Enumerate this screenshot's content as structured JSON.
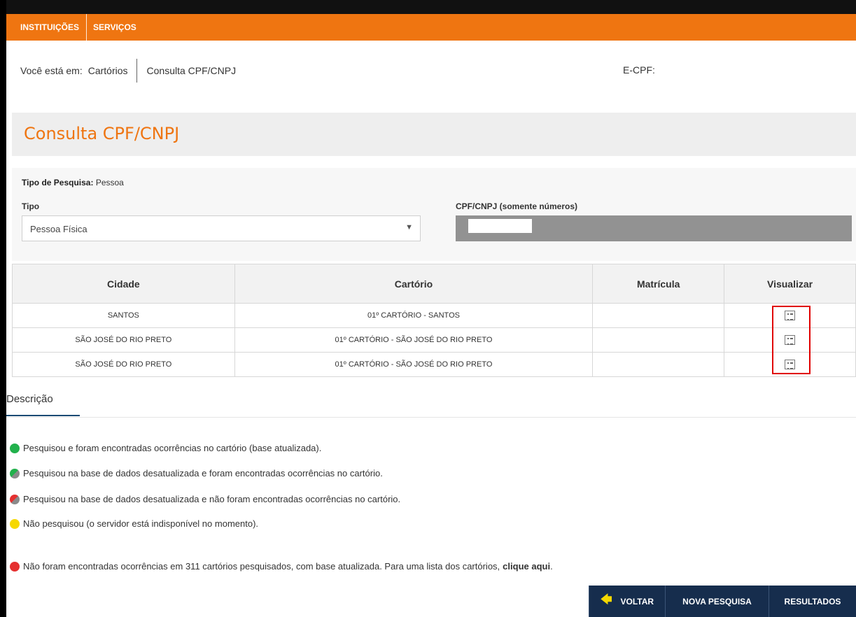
{
  "nav": {
    "items": [
      "INSTITUIÇÕES",
      "SERVIÇOS"
    ]
  },
  "breadcrumb": {
    "prefix": "Você está em:",
    "items": [
      "Cartórios",
      "Consulta CPF/CNPJ"
    ]
  },
  "header": {
    "ecpf_label": "E-CPF:"
  },
  "page_title": "Consulta CPF/CNPJ",
  "form": {
    "tipo_pesquisa_label": "Tipo de Pesquisa:",
    "tipo_pesquisa_value": "Pessoa",
    "tipo_label": "Tipo",
    "tipo_value": "Pessoa Física",
    "cpf_label": "CPF/CNPJ (somente números)",
    "cpf_value": ""
  },
  "table": {
    "headers": [
      "Cidade",
      "Cartório",
      "Matrícula",
      "Visualizar"
    ],
    "rows": [
      {
        "cidade": "SANTOS",
        "cartorio": "01º CARTÓRIO - SANTOS",
        "matricula": ""
      },
      {
        "cidade": "SÃO JOSÉ DO RIO PRETO",
        "cartorio": "01º CARTÓRIO - SÃO JOSÉ DO RIO PRETO",
        "matricula": ""
      },
      {
        "cidade": "SÃO JOSÉ DO RIO PRETO",
        "cartorio": "01º CARTÓRIO - SÃO JOSÉ DO RIO PRETO",
        "matricula": ""
      }
    ]
  },
  "description": {
    "tab_label": "Descrição",
    "legend": [
      {
        "color": "green",
        "text": "Pesquisou e foram encontradas ocorrências no cartório (base atualizada)."
      },
      {
        "color": "green-gray",
        "text": "Pesquisou na base de dados desatualizada e foram encontradas ocorrências no cartório."
      },
      {
        "color": "red-gray",
        "text": "Pesquisou na base de dados desatualizada e não foram encontradas ocorrências no cartório."
      },
      {
        "color": "yellow",
        "text": "Não pesquisou (o servidor está indisponível no momento)."
      }
    ],
    "summary_text": "Não foram encontradas ocorrências em 311 cartórios pesquisados, com base atualizada. Para uma lista dos cartórios,",
    "summary_link": "clique aqui",
    "summary_end": "."
  },
  "buttons": {
    "voltar": "VOLTAR",
    "nova_pesquisa": "NOVA PESQUISA",
    "resultados": "RESULTADOS"
  },
  "colors": {
    "accent": "#ef7511",
    "button_bg": "#162d4d",
    "highlight": "#e00000"
  }
}
